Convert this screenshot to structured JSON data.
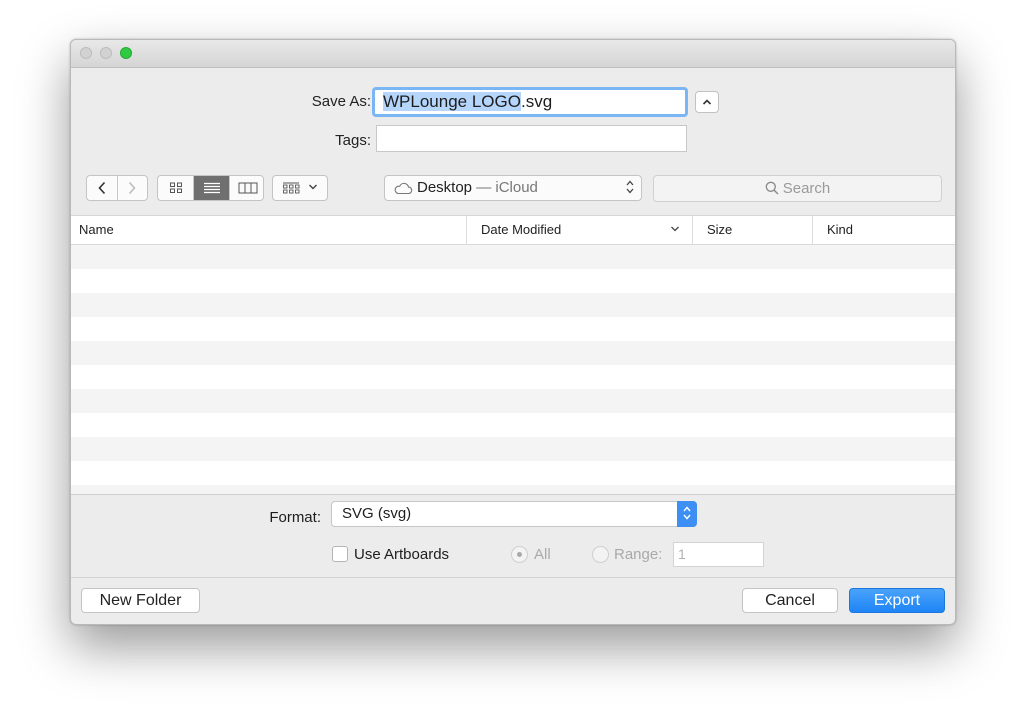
{
  "save": {
    "label": "Save As:",
    "filename_selected": "WPLounge LOGO",
    "filename_ext": ".svg"
  },
  "tags": {
    "label": "Tags:",
    "value": ""
  },
  "location": {
    "name": "Desktop",
    "separator": " — ",
    "service": "iCloud"
  },
  "search": {
    "placeholder": "Search"
  },
  "table": {
    "columns": {
      "name": "Name",
      "date_modified": "Date Modified",
      "size": "Size",
      "kind": "Kind"
    },
    "sort_column": "date_modified"
  },
  "format": {
    "label": "Format:",
    "value": "SVG (svg)"
  },
  "options": {
    "use_artboards_label": "Use Artboards",
    "use_artboards_checked": false,
    "all_label": "All",
    "range_label": "Range:",
    "range_value": "1"
  },
  "buttons": {
    "new_folder": "New Folder",
    "cancel": "Cancel",
    "export": "Export"
  },
  "colors": {
    "accent": "#1e84f5",
    "focus_ring": "#7ab6f4",
    "selection": "#b5d5fb"
  },
  "icons": {
    "back": "chevron-left-icon",
    "forward": "chevron-right-icon",
    "expand": "chevron-up-icon",
    "location": "cloud-icon",
    "search": "magnifier-icon"
  }
}
